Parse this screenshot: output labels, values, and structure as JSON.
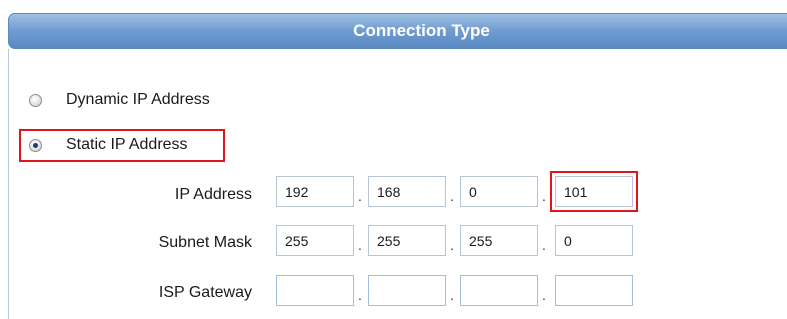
{
  "header": {
    "title": "Connection Type"
  },
  "options": [
    {
      "label": "Dynamic IP Address",
      "selected": false
    },
    {
      "label": "Static IP Address",
      "selected": true
    }
  ],
  "fields": {
    "ip": {
      "label": "IP Address",
      "octets": [
        "192",
        "168",
        "0",
        "101"
      ]
    },
    "subnet": {
      "label": "Subnet Mask",
      "octets": [
        "255",
        "255",
        "255",
        "0"
      ]
    },
    "gateway": {
      "label": "ISP Gateway",
      "octets": [
        "",
        "",
        "",
        ""
      ]
    }
  },
  "separator": ".",
  "colors": {
    "header": "#6f9bd0",
    "highlight": "#e0141b"
  }
}
